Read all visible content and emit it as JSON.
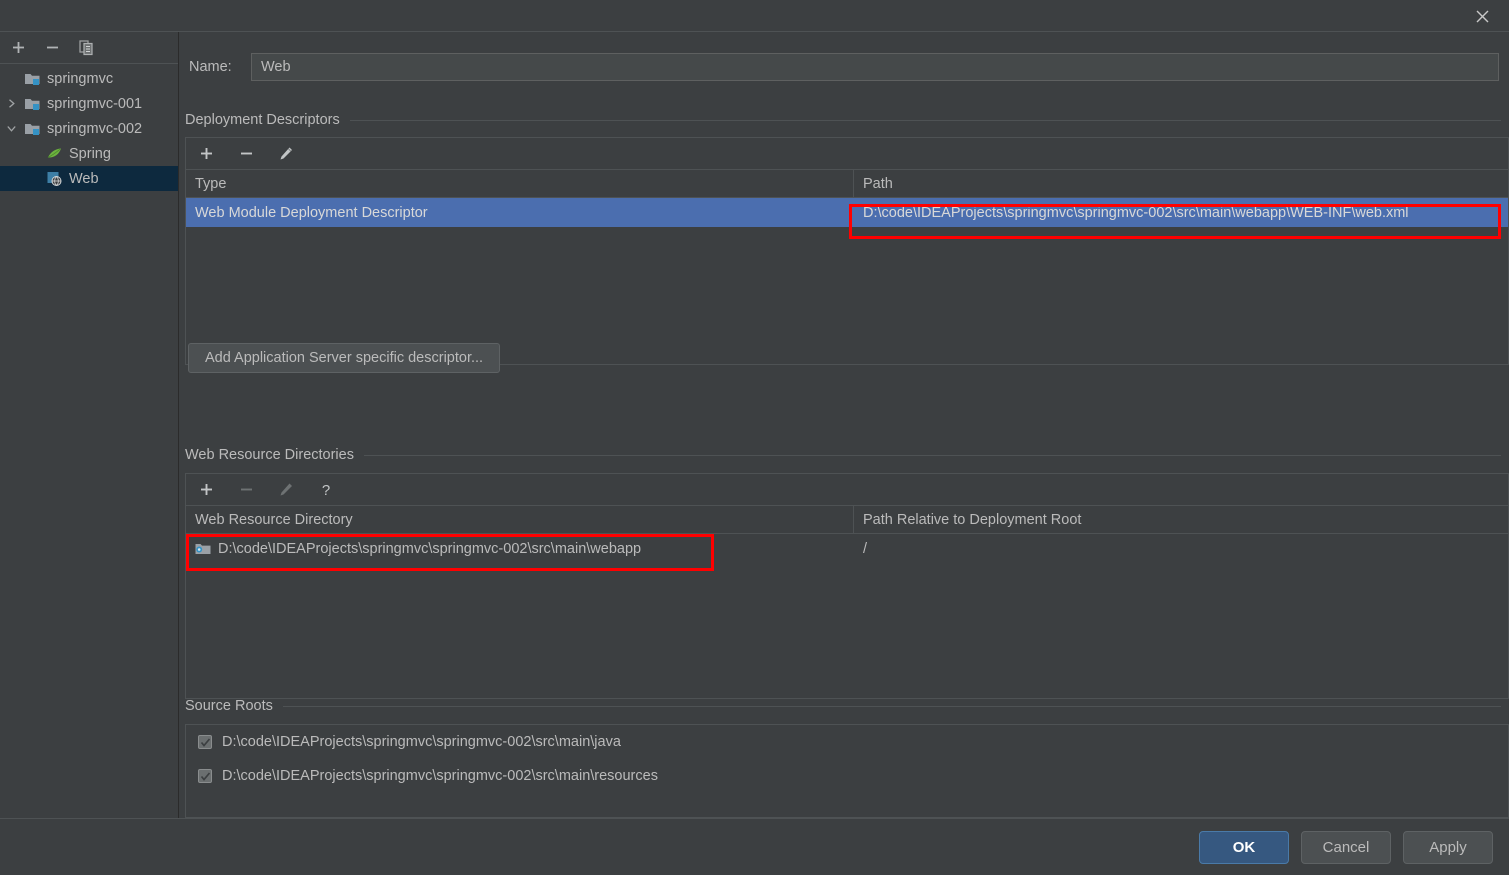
{
  "window": {
    "close_icon": "close-icon"
  },
  "sidebar": {
    "toolbar": [
      {
        "name": "add-module-button",
        "icon": "plus-icon",
        "label": "+"
      },
      {
        "name": "remove-module-button",
        "icon": "minus-icon",
        "label": "−"
      },
      {
        "name": "copy-module-button",
        "icon": "copy-icon",
        "label": "copy"
      }
    ],
    "tree": [
      {
        "label": "springmvc",
        "icon": "module-icon",
        "arrow": "",
        "level": 1,
        "selected": false
      },
      {
        "label": "springmvc-001",
        "icon": "module-icon",
        "arrow": "collapsed",
        "level": 0,
        "selected": false
      },
      {
        "label": "springmvc-002",
        "icon": "module-icon",
        "arrow": "expanded",
        "level": 0,
        "selected": false
      },
      {
        "label": "Spring",
        "icon": "spring-leaf-icon",
        "arrow": "",
        "level": 2,
        "selected": false
      },
      {
        "label": "Web",
        "icon": "web-facet-icon",
        "arrow": "",
        "level": 2,
        "selected": true
      }
    ]
  },
  "main": {
    "name_label": "Name:",
    "name_value": "Web",
    "deployment_descriptors": {
      "title": "Deployment Descriptors",
      "toolbar": [
        {
          "name": "add-descriptor-button",
          "icon": "plus-icon",
          "enabled": true
        },
        {
          "name": "remove-descriptor-button",
          "icon": "minus-icon",
          "enabled": true
        },
        {
          "name": "edit-descriptor-button",
          "icon": "pencil-icon",
          "enabled": true
        }
      ],
      "columns": [
        "Type",
        "Path"
      ],
      "rows": [
        {
          "type": "Web Module Deployment Descriptor",
          "path": "D:\\code\\IDEAProjects\\springmvc\\springmvc-002\\src\\main\\webapp\\WEB-INF\\web.xml",
          "selected": true
        }
      ],
      "add_server_descriptor_label": "Add Application Server specific descriptor..."
    },
    "web_resource_directories": {
      "title": "Web Resource Directories",
      "toolbar": [
        {
          "name": "add-web-resource-button",
          "icon": "plus-icon",
          "enabled": true
        },
        {
          "name": "remove-web-resource-button",
          "icon": "minus-icon",
          "enabled": false
        },
        {
          "name": "edit-web-resource-button",
          "icon": "pencil-icon",
          "enabled": false
        },
        {
          "name": "help-web-resource-button",
          "icon": "question-icon",
          "enabled": true
        }
      ],
      "columns": [
        "Web Resource Directory",
        "Path Relative to Deployment Root"
      ],
      "rows": [
        {
          "directory": "D:\\code\\IDEAProjects\\springmvc\\springmvc-002\\src\\main\\webapp",
          "relative_path": "/",
          "icon": "folder-icon"
        }
      ]
    },
    "source_roots": {
      "title": "Source Roots",
      "items": [
        {
          "path": "D:\\code\\IDEAProjects\\springmvc\\springmvc-002\\src\\main\\java",
          "checked": true
        },
        {
          "path": "D:\\code\\IDEAProjects\\springmvc\\springmvc-002\\src\\main\\resources",
          "checked": true
        }
      ]
    }
  },
  "footer": {
    "ok_label": "OK",
    "cancel_label": "Cancel",
    "apply_label": "Apply"
  },
  "colors": {
    "background": "#3c3f41",
    "selection_blue": "#4b6eaf",
    "tree_selection": "#0d293e",
    "primary_button": "#365880",
    "annotation_red": "#ff0000",
    "border": "#4e5254"
  }
}
